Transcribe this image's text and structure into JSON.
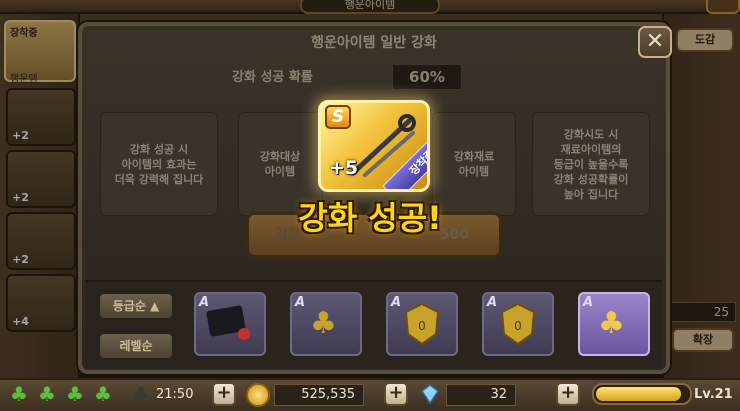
{
  "top": {
    "title": "행운아이템"
  },
  "left_panel": {
    "tab_label": "장착중",
    "tab_sub": "행운템",
    "slot_plus": [
      "+2",
      "+2",
      "+2",
      "+2",
      "+2",
      "+4"
    ]
  },
  "right_panel": {
    "dex_button": "도감",
    "count": "25",
    "expand_button": "확장"
  },
  "dialog": {
    "title": "행운아이템 일반 강화",
    "success_rate_label": "강화 성공 확률",
    "success_rate_value": "60%",
    "info_left": "강화 성공 시\n아이템의 효과는\n더욱 강력해 집니다",
    "target_slot_label": "강화대상\n아이템",
    "material_slot_label": "강화재료\n아이템",
    "info_right": "강화시도 시\n재료아이템의\n등급이 높을수록\n강화 성공확률이\n높아 집니다",
    "action_button": "강화",
    "action_cost": "500",
    "close_icon": "✕"
  },
  "inventory": {
    "sort_grade": "등급순 ▲",
    "sort_level": "레벨순",
    "items": [
      {
        "grade": "A",
        "icon": "black-card-icon"
      },
      {
        "grade": "A",
        "icon": "clover-icon"
      },
      {
        "grade": "A",
        "icon": "badge-icon"
      },
      {
        "grade": "A",
        "icon": "badge-icon"
      },
      {
        "grade": "A",
        "icon": "clover-icon"
      }
    ]
  },
  "result": {
    "grade_badge": "S",
    "plus_level": "+5",
    "equipped_ribbon": "장착중",
    "success_text": "강화 성공!"
  },
  "status_bar": {
    "clovers": [
      true,
      true,
      true,
      true,
      false
    ],
    "timer": "21:50",
    "gold": "525,535",
    "gems": "32",
    "level": "Lv.21",
    "xp_fraction": 0.92
  },
  "colors": {
    "success_text": "#ffd51a",
    "gold_card": "#f2c13a",
    "ribbon": "#5a4fc0",
    "clover": "#57c23a"
  }
}
